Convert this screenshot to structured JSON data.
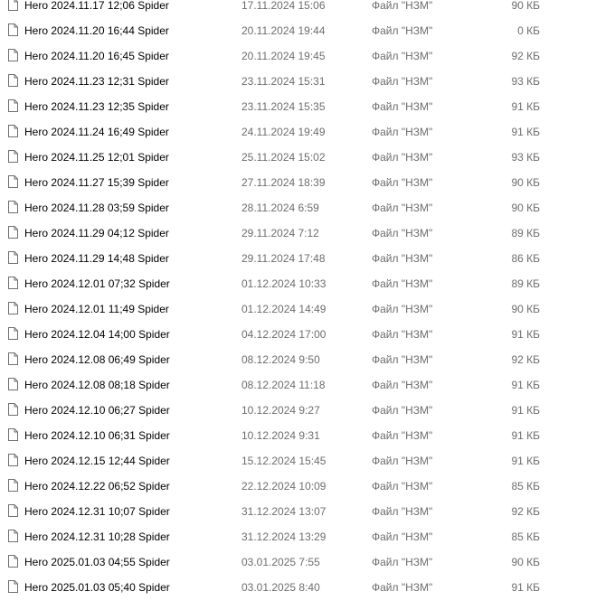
{
  "file_icon": "generic-file-icon",
  "files": [
    {
      "name": "Hero 2024.11.17 12;06 Spider",
      "date": "17.11.2024 15:06",
      "type": "Файл \"НЗМ\"",
      "size": "90 КБ"
    },
    {
      "name": "Hero 2024.11.20 16;44 Spider",
      "date": "20.11.2024 19:44",
      "type": "Файл \"НЗМ\"",
      "size": "0 КБ"
    },
    {
      "name": "Hero 2024.11.20 16;45 Spider",
      "date": "20.11.2024 19:45",
      "type": "Файл \"НЗМ\"",
      "size": "92 КБ"
    },
    {
      "name": "Hero 2024.11.23 12;31 Spider",
      "date": "23.11.2024 15:31",
      "type": "Файл \"НЗМ\"",
      "size": "93 КБ"
    },
    {
      "name": "Hero 2024.11.23 12;35 Spider",
      "date": "23.11.2024 15:35",
      "type": "Файл \"НЗМ\"",
      "size": "91 КБ"
    },
    {
      "name": "Hero 2024.11.24 16;49 Spider",
      "date": "24.11.2024 19:49",
      "type": "Файл \"НЗМ\"",
      "size": "91 КБ"
    },
    {
      "name": "Hero 2024.11.25 12;01 Spider",
      "date": "25.11.2024 15:02",
      "type": "Файл \"НЗМ\"",
      "size": "93 КБ"
    },
    {
      "name": "Hero 2024.11.27 15;39 Spider",
      "date": "27.11.2024 18:39",
      "type": "Файл \"НЗМ\"",
      "size": "90 КБ"
    },
    {
      "name": "Hero 2024.11.28 03;59 Spider",
      "date": "28.11.2024 6:59",
      "type": "Файл \"НЗМ\"",
      "size": "90 КБ"
    },
    {
      "name": "Hero 2024.11.29 04;12 Spider",
      "date": "29.11.2024 7:12",
      "type": "Файл \"НЗМ\"",
      "size": "89 КБ"
    },
    {
      "name": "Hero 2024.11.29 14;48 Spider",
      "date": "29.11.2024 17:48",
      "type": "Файл \"НЗМ\"",
      "size": "86 КБ"
    },
    {
      "name": "Hero 2024.12.01 07;32 Spider",
      "date": "01.12.2024 10:33",
      "type": "Файл \"НЗМ\"",
      "size": "89 КБ"
    },
    {
      "name": "Hero 2024.12.01 11;49 Spider",
      "date": "01.12.2024 14:49",
      "type": "Файл \"НЗМ\"",
      "size": "90 КБ"
    },
    {
      "name": "Hero 2024.12.04 14;00 Spider",
      "date": "04.12.2024 17:00",
      "type": "Файл \"НЗМ\"",
      "size": "91 КБ"
    },
    {
      "name": "Hero 2024.12.08 06;49 Spider",
      "date": "08.12.2024 9:50",
      "type": "Файл \"НЗМ\"",
      "size": "92 КБ"
    },
    {
      "name": "Hero 2024.12.08 08;18 Spider",
      "date": "08.12.2024 11:18",
      "type": "Файл \"НЗМ\"",
      "size": "91 КБ"
    },
    {
      "name": "Hero 2024.12.10 06;27 Spider",
      "date": "10.12.2024 9:27",
      "type": "Файл \"НЗМ\"",
      "size": "91 КБ"
    },
    {
      "name": "Hero 2024.12.10 06;31 Spider",
      "date": "10.12.2024 9:31",
      "type": "Файл \"НЗМ\"",
      "size": "91 КБ"
    },
    {
      "name": "Hero 2024.12.15 12;44 Spider",
      "date": "15.12.2024 15:45",
      "type": "Файл \"НЗМ\"",
      "size": "91 КБ"
    },
    {
      "name": "Hero 2024.12.22 06;52 Spider",
      "date": "22.12.2024 10:09",
      "type": "Файл \"НЗМ\"",
      "size": "85 КБ"
    },
    {
      "name": "Hero 2024.12.31 10;07 Spider",
      "date": "31.12.2024 13:07",
      "type": "Файл \"НЗМ\"",
      "size": "92 КБ"
    },
    {
      "name": "Hero 2024.12.31 10;28 Spider",
      "date": "31.12.2024 13:29",
      "type": "Файл \"НЗМ\"",
      "size": "85 КБ"
    },
    {
      "name": "Hero 2025.01.03 04;55 Spider",
      "date": "03.01.2025 7:55",
      "type": "Файл \"НЗМ\"",
      "size": "90 КБ"
    },
    {
      "name": "Hero 2025.01.03 05;40 Spider",
      "date": "03.01.2025 8:40",
      "type": "Файл \"НЗМ\"",
      "size": "91 КБ"
    }
  ]
}
